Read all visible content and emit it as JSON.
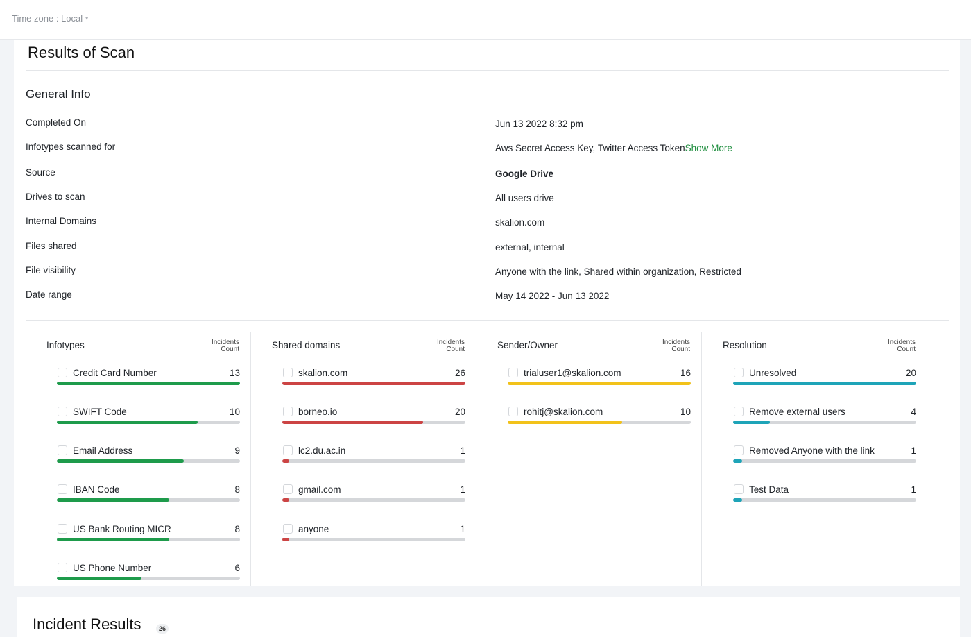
{
  "topbar": {
    "timezone_label": "Time zone : Local",
    "caret": "▾"
  },
  "page_title": "Results of Scan",
  "general_info": {
    "title": "General Info",
    "rows": [
      {
        "label": "Completed On",
        "value": "Jun 13 2022 8:32 pm"
      },
      {
        "label": "Infotypes scanned for",
        "value": "Aws Secret Access Key, Twitter Access Token",
        "link": "Show More"
      },
      {
        "label": "Source",
        "value": "Google Drive"
      },
      {
        "label": "Drives to scan",
        "value": "All users drive"
      },
      {
        "label": "Internal Domains",
        "value": "skalion.com"
      },
      {
        "label": "Files shared",
        "value": "external, internal"
      },
      {
        "label": "File visibility",
        "value": "Anyone with the link, Shared within organization, Restricted"
      },
      {
        "label": "Date range",
        "value": "May 14 2022 - Jun 13 2022"
      }
    ]
  },
  "panels": [
    {
      "title": "Infotypes",
      "count_header_1": "Incidents",
      "count_header_2": "Count",
      "color": "#1e9b4b",
      "max": 13,
      "items": [
        {
          "label": "Credit Card Number",
          "count": "13",
          "value": 13
        },
        {
          "label": "SWIFT Code",
          "count": "10",
          "value": 10
        },
        {
          "label": "Email Address",
          "count": "9",
          "value": 9
        },
        {
          "label": "IBAN Code",
          "count": "8",
          "value": 8
        },
        {
          "label": "US Bank Routing MICR",
          "count": "8",
          "value": 8
        },
        {
          "label": "US Phone Number",
          "count": "6",
          "value": 6
        }
      ]
    },
    {
      "title": "Shared domains",
      "count_header_1": "Incidents",
      "count_header_2": "Count",
      "color": "#cc4444",
      "max": 26,
      "items": [
        {
          "label": "skalion.com",
          "count": "26",
          "value": 26
        },
        {
          "label": "borneo.io",
          "count": "20",
          "value": 20
        },
        {
          "label": "lc2.du.ac.in",
          "count": "1",
          "value": 1
        },
        {
          "label": "gmail.com",
          "count": "1",
          "value": 1
        },
        {
          "label": "anyone",
          "count": "1",
          "value": 1
        }
      ]
    },
    {
      "title": "Sender/Owner",
      "count_header_1": "Incidents",
      "count_header_2": "Count",
      "color": "#f2c21a",
      "max": 16,
      "items": [
        {
          "label": "trialuser1@skalion.com",
          "count": "16",
          "value": 16
        },
        {
          "label": "rohitj@skalion.com",
          "count": "10",
          "value": 10
        }
      ]
    },
    {
      "title": "Resolution",
      "count_header_1": "Incidents",
      "count_header_2": "Count",
      "color": "#1ea4b8",
      "max": 20,
      "items": [
        {
          "label": "Unresolved",
          "count": "20",
          "value": 20
        },
        {
          "label": "Remove external users",
          "count": "4",
          "value": 4
        },
        {
          "label": "Removed Anyone with the link",
          "count": "1",
          "value": 1
        },
        {
          "label": "Test Data",
          "count": "1",
          "value": 1
        }
      ]
    }
  ],
  "incident_results": {
    "title": "Incident Results",
    "badge": "26"
  }
}
